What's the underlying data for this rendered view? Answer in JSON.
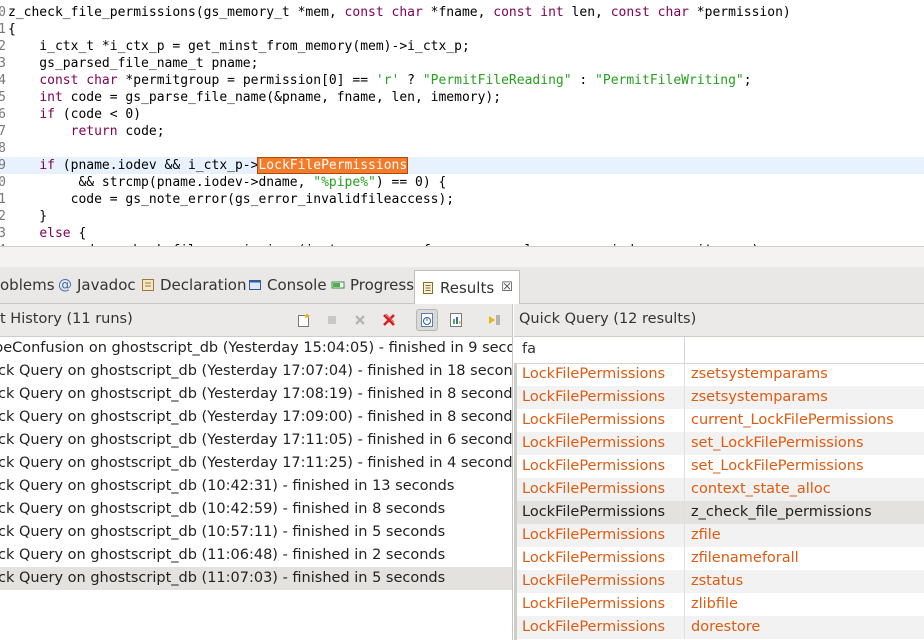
{
  "editor": {
    "lines": [
      {
        "ln": "0",
        "tokens": [
          {
            "t": "z_check_file_permissions(gs_memory_t *mem, "
          },
          {
            "t": "const",
            "c": "k"
          },
          {
            "t": " "
          },
          {
            "t": "char",
            "c": "k"
          },
          {
            "t": " *fname, "
          },
          {
            "t": "const",
            "c": "k"
          },
          {
            "t": " "
          },
          {
            "t": "int",
            "c": "k"
          },
          {
            "t": " len, "
          },
          {
            "t": "const",
            "c": "k"
          },
          {
            "t": " "
          },
          {
            "t": "char",
            "c": "k"
          },
          {
            "t": " *permission)"
          }
        ]
      },
      {
        "ln": "1",
        "tokens": [
          {
            "t": "{"
          }
        ]
      },
      {
        "ln": "2",
        "tokens": [
          {
            "t": "    i_ctx_t *i_ctx_p = get_minst_from_memory(mem)->i_ctx_p;"
          }
        ]
      },
      {
        "ln": "3",
        "tokens": [
          {
            "t": "    gs_parsed_file_name_t pname;"
          }
        ]
      },
      {
        "ln": "4",
        "tokens": [
          {
            "t": "    "
          },
          {
            "t": "const",
            "c": "k"
          },
          {
            "t": " "
          },
          {
            "t": "char",
            "c": "k"
          },
          {
            "t": " *permitgroup = permission[0] == "
          },
          {
            "t": "'r'",
            "c": "g"
          },
          {
            "t": " ? "
          },
          {
            "t": "\"PermitFileReading\"",
            "c": "g"
          },
          {
            "t": " : "
          },
          {
            "t": "\"PermitFileWriting\"",
            "c": "g"
          },
          {
            "t": ";"
          }
        ]
      },
      {
        "ln": "5",
        "tokens": [
          {
            "t": "    "
          },
          {
            "t": "int",
            "c": "k"
          },
          {
            "t": " code = gs_parse_file_name(&pname, fname, len, imemory);"
          }
        ]
      },
      {
        "ln": "6",
        "tokens": [
          {
            "t": "    "
          },
          {
            "t": "if",
            "c": "k"
          },
          {
            "t": " (code < 0)"
          }
        ]
      },
      {
        "ln": "7",
        "tokens": [
          {
            "t": "        "
          },
          {
            "t": "return",
            "c": "k"
          },
          {
            "t": " code;"
          }
        ]
      },
      {
        "ln": "8",
        "tokens": [
          {
            "t": ""
          }
        ]
      },
      {
        "ln": "9",
        "current": true,
        "tokens": [
          {
            "t": "    "
          },
          {
            "t": "if",
            "c": "k"
          },
          {
            "t": " (pname.iodev && i_ctx_p->"
          },
          {
            "t": "LockFilePermissions",
            "c": "hl"
          }
        ]
      },
      {
        "ln": "0",
        "tokens": [
          {
            "t": "         && strcmp(pname.iodev->dname, "
          },
          {
            "t": "\"%pipe%\"",
            "c": "g"
          },
          {
            "t": ") == 0) {"
          }
        ]
      },
      {
        "ln": "1",
        "tokens": [
          {
            "t": "        code = gs_note_error(gs_error_invalidfileaccess);"
          }
        ]
      },
      {
        "ln": "2",
        "tokens": [
          {
            "t": "    }"
          }
        ]
      },
      {
        "ln": "3",
        "tokens": [
          {
            "t": "    "
          },
          {
            "t": "else",
            "c": "k"
          },
          {
            "t": " {"
          }
        ]
      },
      {
        "ln": "4",
        "tokens": [
          {
            "t": "        code = check_file_permissions(i_ctx_p, pname.fname, pname.len, pname.iodev, permitgroup);"
          }
        ]
      }
    ]
  },
  "tabs": [
    {
      "label": "oblems",
      "icon": "problems-icon"
    },
    {
      "label": "Javadoc",
      "icon": "javadoc-icon"
    },
    {
      "label": "Declaration",
      "icon": "declaration-icon"
    },
    {
      "label": "Console",
      "icon": "console-icon"
    },
    {
      "label": "Progress",
      "icon": "progress-icon"
    },
    {
      "label": "Results",
      "icon": "results-icon",
      "active": true,
      "close": "☒"
    }
  ],
  "history": {
    "title": "t History (11 runs)",
    "rows": [
      "peConfusion on ghostscript_db (Yesterday 15:04:05) - finished in 9 seconds",
      "ick Query on ghostscript_db (Yesterday 17:07:04) - finished in 18 seconds",
      "ick Query on ghostscript_db (Yesterday 17:08:19) - finished in 8 seconds",
      "ick Query on ghostscript_db (Yesterday 17:09:00) - finished in 8 seconds",
      "ick Query on ghostscript_db (Yesterday 17:11:05) - finished in 6 seconds",
      "ick Query on ghostscript_db (Yesterday 17:11:25) - finished in 4 seconds",
      "ick Query on ghostscript_db (10:42:31) - finished in 13 seconds",
      "ick Query on ghostscript_db (10:42:59) - finished in 8 seconds",
      "ick Query on ghostscript_db (10:57:11) - finished in 5 seconds",
      "ick Query on ghostscript_db (11:06:48) - finished in 2 seconds",
      "ick Query on ghostscript_db (11:07:03) - finished in 5 seconds"
    ],
    "selected_index": 10
  },
  "results": {
    "title": "Quick Query (12 results)",
    "column_header": "fa",
    "rows": [
      [
        "LockFilePermissions",
        "zsetsystemparams"
      ],
      [
        "LockFilePermissions",
        "zsetsystemparams"
      ],
      [
        "LockFilePermissions",
        "current_LockFilePermissions"
      ],
      [
        "LockFilePermissions",
        "set_LockFilePermissions"
      ],
      [
        "LockFilePermissions",
        "set_LockFilePermissions"
      ],
      [
        "LockFilePermissions",
        "context_state_alloc"
      ],
      [
        "LockFilePermissions",
        "z_check_file_permissions"
      ],
      [
        "LockFilePermissions",
        "zfile"
      ],
      [
        "LockFilePermissions",
        "zfilenameforall"
      ],
      [
        "LockFilePermissions",
        "zstatus"
      ],
      [
        "LockFilePermissions",
        "zlibfile"
      ],
      [
        "LockFilePermissions",
        "dorestore"
      ]
    ],
    "selected_index": 6
  },
  "colors": {
    "keyword": "#7f0055",
    "string": "#26a11f",
    "highlight": "#f47b2a",
    "result_text": "#e05a10"
  }
}
